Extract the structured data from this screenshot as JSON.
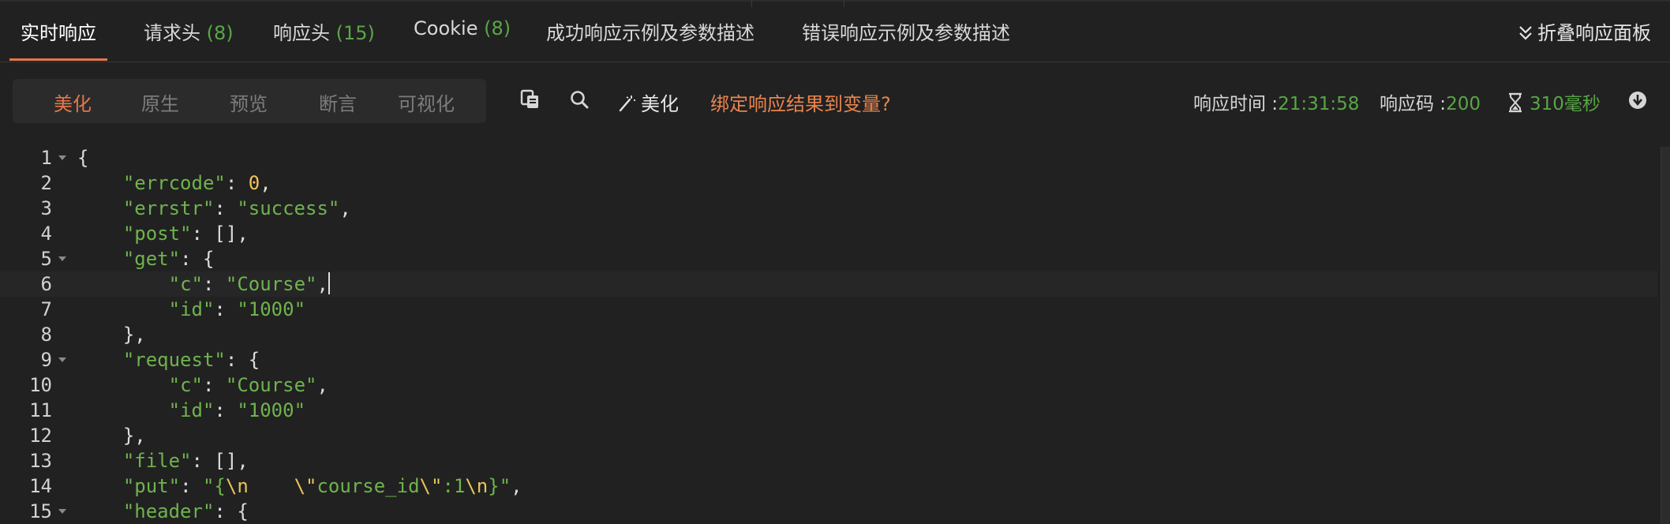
{
  "tabs": [
    {
      "label": "实时响应",
      "count": ""
    },
    {
      "label": "请求头",
      "count": "(8)"
    },
    {
      "label": "响应头",
      "count": "(15)"
    },
    {
      "label": "Cookie",
      "count": "(8)"
    },
    {
      "label": "成功响应示例及参数描述",
      "count": ""
    },
    {
      "label": "错误响应示例及参数描述",
      "count": ""
    }
  ],
  "active_tab": "实时响应",
  "collapse_label": "折叠响应面板",
  "view_modes": [
    "美化",
    "原生",
    "预览",
    "断言",
    "可视化"
  ],
  "active_view_mode": "美化",
  "toolbar": {
    "copy_icon": "copy-icon",
    "search_icon": "search-icon",
    "beautify_label": "美化",
    "bind_link": "绑定响应结果到变量?"
  },
  "meta": {
    "time_label": "响应时间 :",
    "time_value": "21:31:58",
    "code_label": "响应码 :",
    "code_value": "200",
    "duration_value": "310毫秒"
  },
  "editor": {
    "current_line": 6,
    "line_numbers": [
      "1",
      "2",
      "3",
      "4",
      "5",
      "6",
      "7",
      "8",
      "9",
      "10",
      "11",
      "12",
      "13",
      "14",
      "15"
    ],
    "lines": [
      "{",
      "    \"errcode\": 0,",
      "    \"errstr\": \"success\",",
      "    \"post\": [],",
      "    \"get\": {",
      "        \"c\": \"Course\",",
      "        \"id\": \"1000\"",
      "    },",
      "    \"request\": {",
      "        \"c\": \"Course\",",
      "        \"id\": \"1000\"",
      "    },",
      "    \"file\": [],",
      "    \"put\": \"{\\n    \\\"course_id\\\":1\\n}\",",
      "    \"header\": {"
    ]
  },
  "colors": {
    "accent": "#e2774a",
    "green": "#59a646",
    "number": "#f0c35a",
    "background": "#212121"
  }
}
